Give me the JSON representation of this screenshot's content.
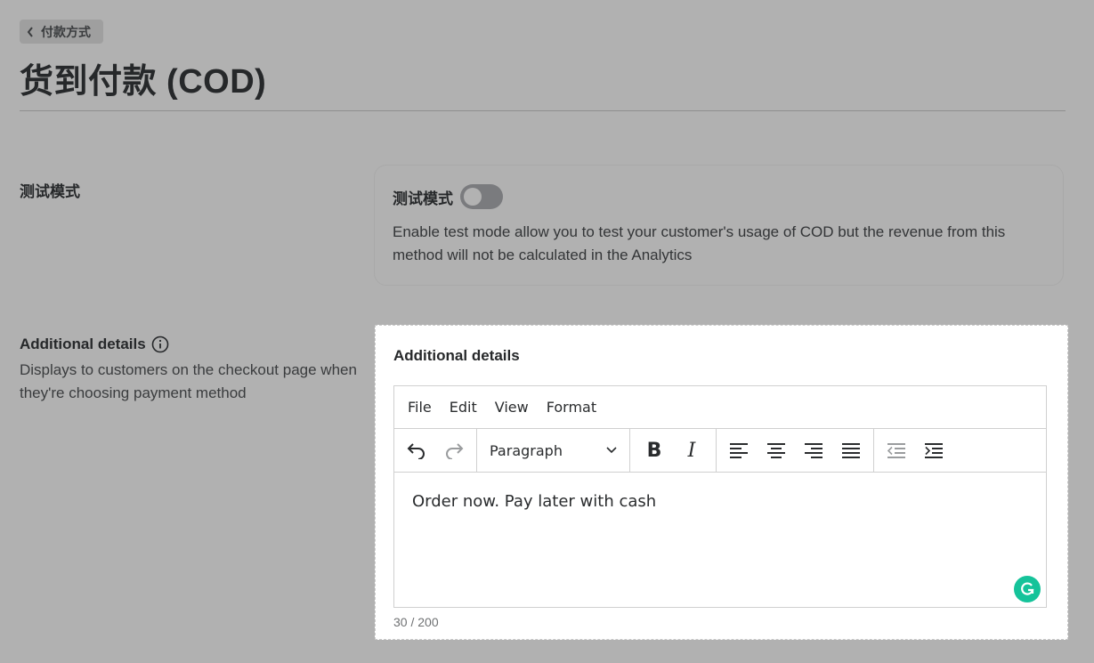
{
  "nav": {
    "back_label": "付款方式"
  },
  "page": {
    "title": "货到付款 (COD)"
  },
  "test_mode": {
    "section_label": "测试模式",
    "card_label": "测试模式",
    "toggle_on": false,
    "description": "Enable test mode allow you to test your customer's usage of COD but the revenue from this method will not be calculated in the Analytics"
  },
  "additional": {
    "section_label": "Additional details",
    "section_description": "Displays to customers on the checkout page when they're choosing payment method",
    "card_title": "Additional details",
    "editor": {
      "menu": [
        "File",
        "Edit",
        "View",
        "Format"
      ],
      "block_format": "Paragraph",
      "content": "Order now. Pay later with cash"
    },
    "char_count": "30 / 200"
  },
  "colors": {
    "grammarly": "#15c39a",
    "overlay_bg": "#b1b1b1"
  }
}
